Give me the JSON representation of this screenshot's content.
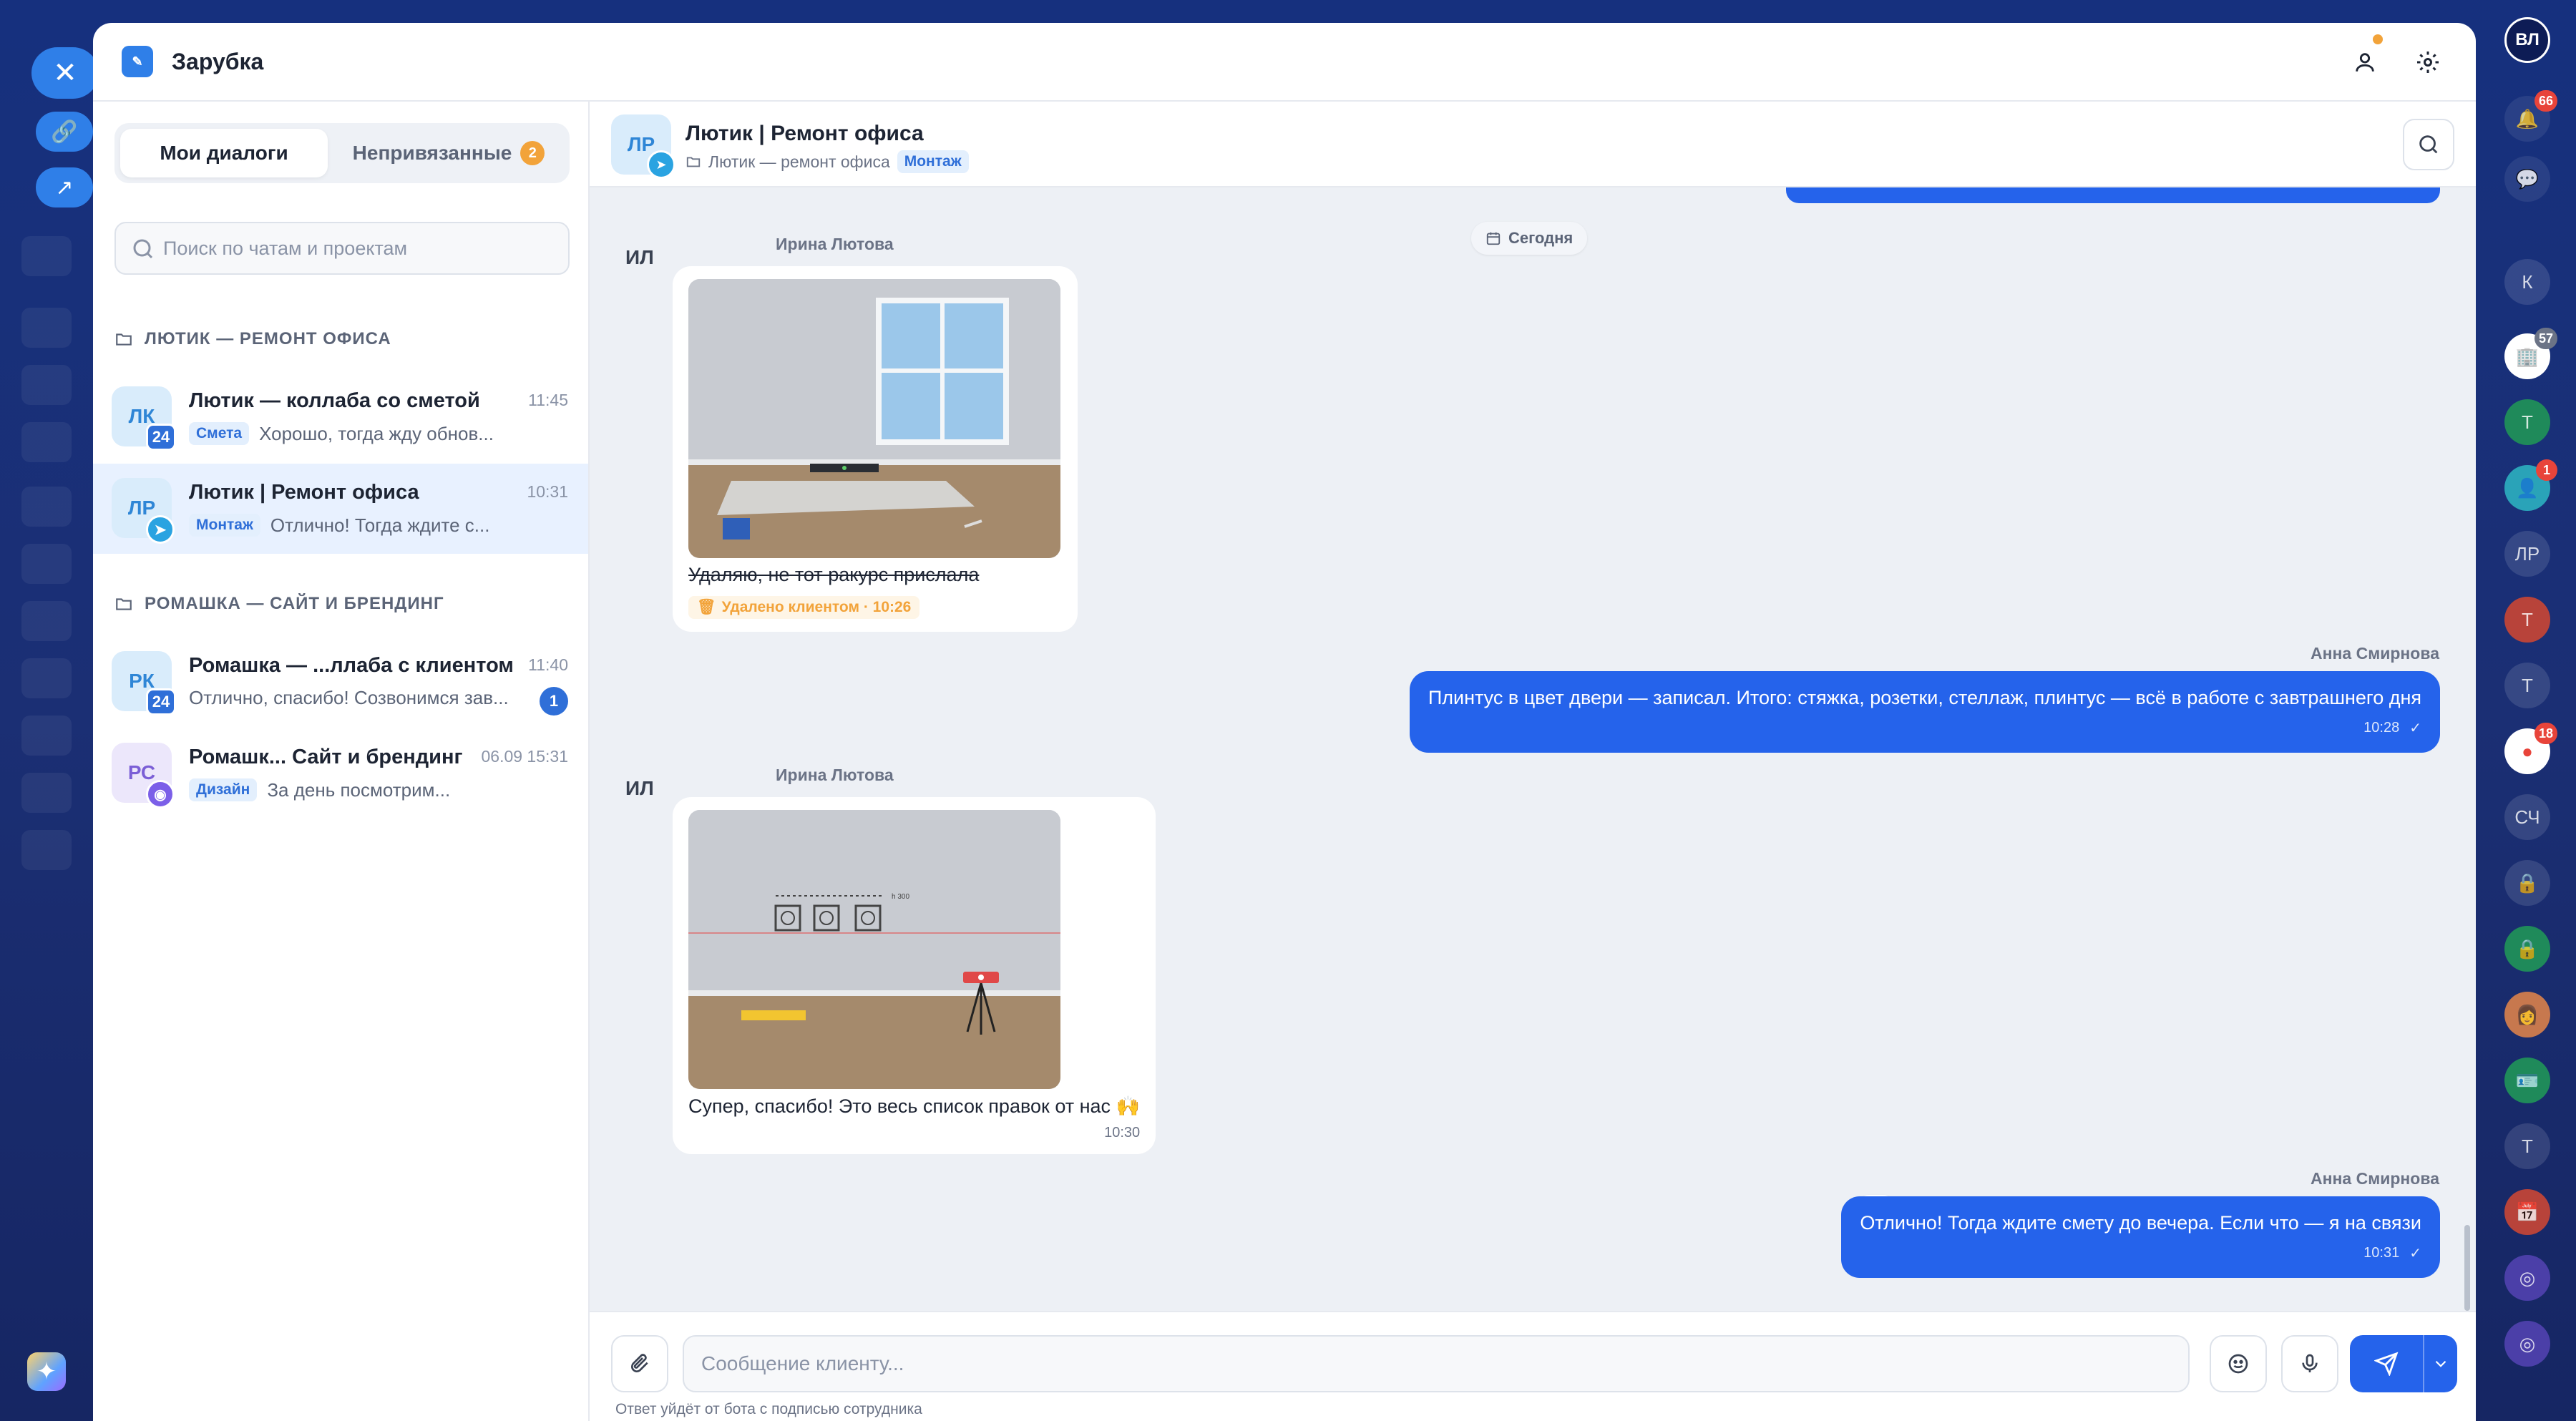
{
  "app": {
    "title": "Зарубка"
  },
  "sidebar": {
    "tabs": [
      {
        "label": "Мои диалоги"
      },
      {
        "label": "Непривязанные",
        "count": "2"
      }
    ],
    "search_placeholder": "Поиск по чатам и проектам",
    "groups": [
      {
        "label": "ЛЮТИК — РЕМОНТ ОФИСА"
      },
      {
        "label": "РОМАШКА — САЙТ И БРЕНДИНГ"
      }
    ],
    "conversations": [
      {
        "initials": "ЛК",
        "badge": "24",
        "name": "Лютик — коллаба со сметой",
        "time": "11:45",
        "tag": "Смета",
        "preview": "Хорошо, тогда жду обнов..."
      },
      {
        "initials": "ЛР",
        "name": "Лютик | Ремонт офиса",
        "time": "10:31",
        "tag": "Монтаж",
        "preview": "Отлично! Тогда ждите с..."
      },
      {
        "initials": "РК",
        "badge": "24",
        "name": "Ромашка — ...ллаба с клиентом",
        "time": "11:40",
        "preview": "Отлично, спасибо! Созвонимся зав...",
        "unread": "1"
      },
      {
        "initials": "РС",
        "name": "Ромашк... Сайт и брендинг",
        "time": "06.09 15:31",
        "tag": "Дизайн",
        "preview": "За день посмотрим..."
      }
    ]
  },
  "chat": {
    "header": {
      "initials": "ЛР",
      "title": "Лютик | Ремонт офиса",
      "path": "Лютик — ремонт офиса",
      "tag": "Монтаж"
    },
    "date_chip": "Сегодня",
    "messages": [
      {
        "sender_initials": "ИЛ",
        "sender": "Ирина Лютова",
        "text": "Удаляю, не тот ракурс прислала",
        "deleted": "Удалено клиентом · 10:26"
      },
      {
        "sender": "Анна Смирнова",
        "text": "Плинтус в цвет двери — записал. Итого: стяжка, розетки, стеллаж, плинтус — всё в работе с завтрашнего дня",
        "time": "10:28"
      },
      {
        "sender_initials": "ИЛ",
        "sender": "Ирина Лютова",
        "text": "Супер, спасибо! Это весь список правок от нас 🙌",
        "time": "10:30",
        "image_label": "h 300"
      },
      {
        "sender": "Анна Смирнова",
        "text": "Отлично! Тогда ждите смету до вечера. Если что — я на связи",
        "time": "10:31"
      }
    ],
    "composer": {
      "placeholder": "Сообщение клиенту...",
      "hint": "Ответ уйдёт от бота с подписью сотрудника"
    }
  },
  "right_rail": {
    "badges": {
      "bell": "66",
      "app2": "57",
      "app4": "1",
      "app10": "18"
    },
    "initials": [
      "К",
      "Т",
      "ЛР",
      "Т",
      "Т",
      "СЧ",
      "Т"
    ]
  },
  "colors": {
    "accent": "#2563eb",
    "warning": "#f2a33a",
    "sidebar_bg": "#1a2f7a"
  }
}
